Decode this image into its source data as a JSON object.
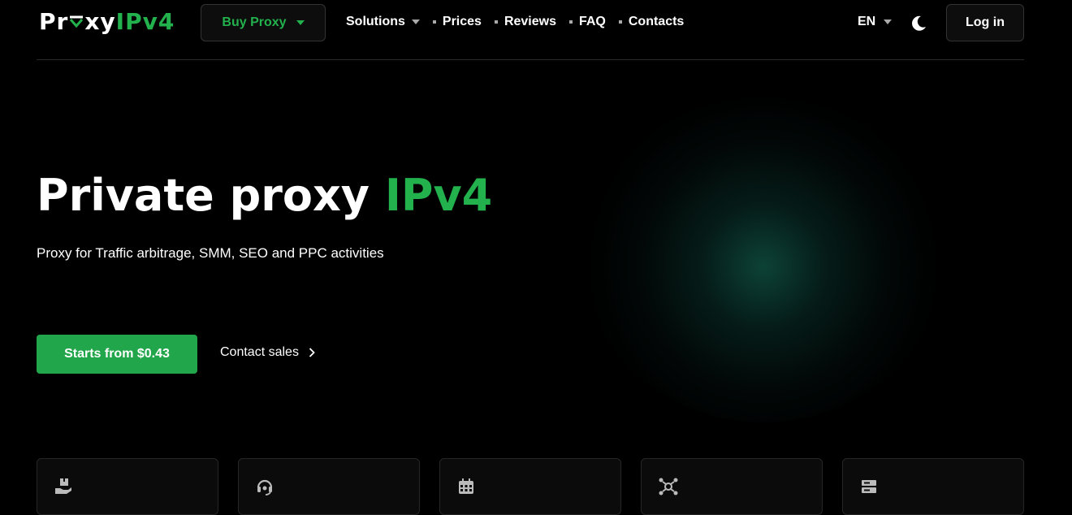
{
  "header": {
    "logo": {
      "part1": "Pr",
      "part2": "xy",
      "part3": "IPv4"
    },
    "buy_label": "Buy Proxy",
    "nav": [
      {
        "label": "Solutions",
        "has_dropdown": true
      },
      {
        "label": "Prices"
      },
      {
        "label": "Reviews"
      },
      {
        "label": "FAQ"
      },
      {
        "label": "Contacts"
      }
    ],
    "lang": "EN",
    "login_label": "Log in"
  },
  "hero": {
    "title_main": "Private proxy ",
    "title_accent": "IPv4",
    "subtitle": "Proxy for Traffic arbitrage, SMM, SEO and PPC activities",
    "cta_label": "Starts from $0.43",
    "contact_label": "Contact sales"
  },
  "cards": [
    {
      "icon": "hand-box-icon"
    },
    {
      "icon": "headset-icon"
    },
    {
      "icon": "calendar-icon"
    },
    {
      "icon": "network-icon"
    },
    {
      "icon": "server-icon"
    }
  ],
  "colors": {
    "accent": "#22b14c",
    "background": "#000000",
    "card": "#0b0b0b"
  }
}
